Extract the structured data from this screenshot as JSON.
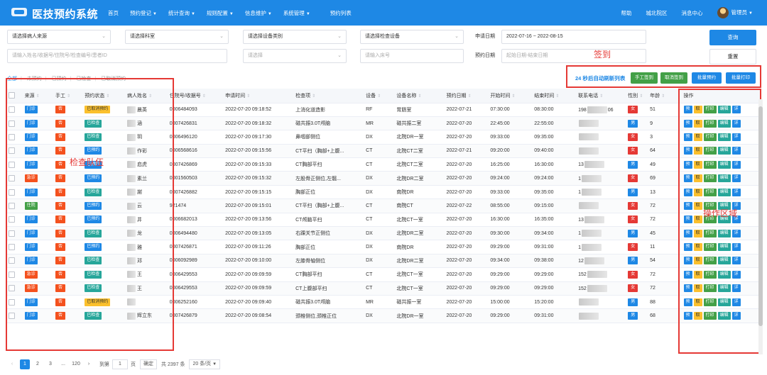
{
  "header": {
    "title": "医技预约系统",
    "nav": [
      {
        "label": "首页",
        "caret": false
      },
      {
        "label": "预约登记",
        "caret": true
      },
      {
        "label": "统计查询",
        "caret": true
      },
      {
        "label": "规则配置",
        "caret": true
      },
      {
        "label": "信息维护",
        "caret": true
      },
      {
        "label": "系统管理",
        "caret": true
      },
      {
        "label": "预约列表",
        "caret": false
      }
    ],
    "right": {
      "help": "帮助",
      "campus": "城北院区",
      "messages": "消息中心",
      "user": "管理员"
    }
  },
  "filters": {
    "patient_source": "请选择病人来源",
    "department": "请选择科室",
    "device_category": "请选择设备类别",
    "check_device": "请选择检查设备",
    "apply_date_label": "申请日期",
    "apply_date_value": "2022-07-16 ~ 2022-08-15",
    "search_placeholder": "请输入姓名/收据号/住院号/检查编号/患者ID",
    "select_placeholder": "请选择",
    "bed_placeholder": "请输入床号",
    "book_date_label": "预约日期",
    "book_date_placeholder": "起始日期-结束日期",
    "query_button": "查询",
    "reset_button": "重置"
  },
  "status_tabs": [
    "全部",
    "未预约",
    "已预约",
    "已检查",
    "已取消预约"
  ],
  "actions": {
    "refresh_text": "24 秒后自动刷新列表",
    "manual_checkin": "手工签到",
    "cancel_checkin": "取消签到",
    "batch_book": "批量预约",
    "batch_print": "批量打印"
  },
  "annotations": {
    "checkin": "签到",
    "check_queue": "检查队伍",
    "op_area": "操作区域"
  },
  "table": {
    "columns": [
      "来源",
      "手工",
      "预约状态",
      "病人姓名",
      "住院号/收据号",
      "申请时间",
      "检查项",
      "设备",
      "设备名称",
      "预约日期",
      "开始时间",
      "结束时间",
      "联系电话",
      "性别",
      "年龄",
      "",
      "操作"
    ],
    "op_labels": {
      "book": "预",
      "cancel": "取",
      "print": "打印",
      "edit": "编辑",
      "detail": "详"
    },
    "rows": [
      {
        "source": "门诊",
        "src": "mz",
        "manual": "否",
        "status": "已取消预约",
        "st": "cancel",
        "name": "晨英",
        "receipt": "0006484093",
        "apply": "2022-07-20 09:18:52",
        "item": "上消化道造影",
        "dev": "RF",
        "devname": "胃肠室",
        "bdate": "2022-07-21",
        "start": "07:30:00",
        "end": "08:30:00",
        "phone": "198",
        "phone_tail": "06",
        "sex": "女",
        "sx": "f",
        "age": "51"
      },
      {
        "source": "门诊",
        "src": "mz",
        "manual": "否",
        "status": "已检查",
        "st": "done",
        "name": "涵",
        "receipt": "0007426831",
        "apply": "2022-07-20 09:18:32",
        "item": "磁共振3.0T颅脑",
        "dev": "MR",
        "devname": "磁共振二室",
        "bdate": "2022-07-20",
        "start": "22:45:00",
        "end": "22:55:00",
        "phone": "",
        "phone_tail": "",
        "sex": "男",
        "sx": "m",
        "age": "9"
      },
      {
        "source": "门诊",
        "src": "mz",
        "manual": "否",
        "status": "已检查",
        "st": "done",
        "name": "玥",
        "receipt": "0006496120",
        "apply": "2022-07-20 09:17:30",
        "item": "鼻咽部侧位",
        "dev": "DX",
        "devname": "北院DR一室",
        "bdate": "2022-07-20",
        "start": "09:33:00",
        "end": "09:35:00",
        "phone": "",
        "phone_tail": "",
        "sex": "女",
        "sx": "f",
        "age": "3"
      },
      {
        "source": "门诊",
        "src": "mz",
        "manual": "否",
        "status": "已预约",
        "st": "booked",
        "name": "作彩",
        "receipt": "0006568616",
        "apply": "2022-07-20 09:15:56",
        "item": "CT平扫（胸部+上腹...",
        "dev": "CT",
        "devname": "北院CT二室",
        "bdate": "2022-07-21",
        "start": "09:20:00",
        "end": "09:40:00",
        "phone": "",
        "phone_tail": "",
        "sex": "女",
        "sx": "f",
        "age": "64"
      },
      {
        "source": "门诊",
        "src": "mz",
        "manual": "否",
        "status": "已预约",
        "st": "booked",
        "name": "启虎",
        "receipt": "0007426869",
        "apply": "2022-07-20 09:15:33",
        "item": "CT胸部平扫",
        "dev": "CT",
        "devname": "北院CT二室",
        "bdate": "2022-07-20",
        "start": "16:25:00",
        "end": "16:30:00",
        "phone": "13",
        "phone_tail": "",
        "sex": "男",
        "sx": "m",
        "age": "49"
      },
      {
        "source": "急诊",
        "src": "jz",
        "manual": "否",
        "status": "已预约",
        "st": "booked",
        "name": "素兰",
        "receipt": "0001560503",
        "apply": "2022-07-20 09:15:32",
        "item": "左股骨正侧位,左髋...",
        "dev": "DX",
        "devname": "北院DR二室",
        "bdate": "2022-07-20",
        "start": "09:24:00",
        "end": "09:24:00",
        "phone": "1",
        "phone_tail": "",
        "sex": "女",
        "sx": "f",
        "age": "69"
      },
      {
        "source": "门诊",
        "src": "mz",
        "manual": "否",
        "status": "已检查",
        "st": "done",
        "name": "謝",
        "receipt": "0007426882",
        "apply": "2022-07-20 09:15:15",
        "item": "胸部正位",
        "dev": "DX",
        "devname": "南院DR",
        "bdate": "2022-07-20",
        "start": "09:33:00",
        "end": "09:35:00",
        "phone": "1",
        "phone_tail": "",
        "sex": "男",
        "sx": "m",
        "age": "13"
      },
      {
        "source": "住院",
        "src": "zy",
        "manual": "否",
        "status": "已预约",
        "st": "booked",
        "name": "云",
        "receipt": "921474",
        "apply": "2022-07-20 09:15:01",
        "item": "CT平扫（胸部+上腹...",
        "dev": "CT",
        "devname": "南院CT",
        "bdate": "2022-07-22",
        "start": "08:55:00",
        "end": "09:15:00",
        "phone": "",
        "phone_tail": "",
        "sex": "女",
        "sx": "f",
        "age": "72"
      },
      {
        "source": "门诊",
        "src": "mz",
        "manual": "否",
        "status": "已预约",
        "st": "booked",
        "name": "井",
        "receipt": "0006682013",
        "apply": "2022-07-20 09:13:56",
        "item": "CT颅脑平扫",
        "dev": "CT",
        "devname": "北院CT一室",
        "bdate": "2022-07-20",
        "start": "16:30:00",
        "end": "16:35:00",
        "phone": "13",
        "phone_tail": "",
        "sex": "女",
        "sx": "f",
        "age": "72"
      },
      {
        "source": "门诊",
        "src": "mz",
        "manual": "否",
        "status": "已检查",
        "st": "done",
        "name": "龙",
        "receipt": "0006494480",
        "apply": "2022-07-20 09:13:05",
        "item": "右踝关节正侧位",
        "dev": "DX",
        "devname": "北院DR二室",
        "bdate": "2022-07-20",
        "start": "09:30:00",
        "end": "09:34:00",
        "phone": "1",
        "phone_tail": "",
        "sex": "男",
        "sx": "m",
        "age": "45"
      },
      {
        "source": "门诊",
        "src": "mz",
        "manual": "否",
        "status": "已预约",
        "st": "booked",
        "name": "雅",
        "receipt": "0007426871",
        "apply": "2022-07-20 09:11:26",
        "item": "胸部正位",
        "dev": "DX",
        "devname": "南院DR",
        "bdate": "2022-07-20",
        "start": "09:29:00",
        "end": "09:31:00",
        "phone": "1",
        "phone_tail": "",
        "sex": "女",
        "sx": "f",
        "age": "11"
      },
      {
        "source": "门诊",
        "src": "mz",
        "manual": "否",
        "status": "已检查",
        "st": "done",
        "name": "邓",
        "receipt": "0006092989",
        "apply": "2022-07-20 09:10:00",
        "item": "左膝骨轴侧位",
        "dev": "DX",
        "devname": "北院DR二室",
        "bdate": "2022-07-20",
        "start": "09:34:00",
        "end": "09:38:00",
        "phone": "12",
        "phone_tail": "",
        "sex": "男",
        "sx": "m",
        "age": "54"
      },
      {
        "source": "急诊",
        "src": "jz",
        "manual": "否",
        "status": "已检查",
        "st": "done",
        "name": "王",
        "receipt": "0006429553",
        "apply": "2022-07-20 09:09:59",
        "item": "CT胸部平扫",
        "dev": "CT",
        "devname": "北院CT一室",
        "bdate": "2022-07-20",
        "start": "09:29:00",
        "end": "09:29:00",
        "phone": "152",
        "phone_tail": "",
        "sex": "女",
        "sx": "f",
        "age": "72"
      },
      {
        "source": "急诊",
        "src": "jz",
        "manual": "否",
        "status": "已检查",
        "st": "done",
        "name": "王",
        "receipt": "0006429553",
        "apply": "2022-07-20 09:09:59",
        "item": "CT上腹部平扫",
        "dev": "CT",
        "devname": "北院CT一室",
        "bdate": "2022-07-20",
        "start": "09:29:00",
        "end": "09:29:00",
        "phone": "152",
        "phone_tail": "",
        "sex": "女",
        "sx": "f",
        "age": "72"
      },
      {
        "source": "门诊",
        "src": "mz",
        "manual": "否",
        "status": "已取消预约",
        "st": "cancel",
        "name": "",
        "receipt": "0006252160",
        "apply": "2022-07-20 09:09:40",
        "item": "磁共振3.0T颅脑",
        "dev": "MR",
        "devname": "磁共振一室",
        "bdate": "2022-07-20",
        "start": "15:00:00",
        "end": "15:20:00",
        "phone": "",
        "phone_tail": "",
        "sex": "男",
        "sx": "m",
        "age": "88"
      },
      {
        "source": "门诊",
        "src": "mz",
        "manual": "否",
        "status": "已检查",
        "st": "done",
        "name": "辉立东",
        "receipt": "0007426879",
        "apply": "2022-07-20 09:08:54",
        "item": "颈椎侧位,颈椎正位",
        "dev": "DX",
        "devname": "北院DR一室",
        "bdate": "2022-07-20",
        "start": "09:29:00",
        "end": "09:31:00",
        "phone": "",
        "phone_tail": "",
        "sex": "男",
        "sx": "m",
        "age": "68"
      }
    ]
  },
  "pager": {
    "p1": "1",
    "p2": "2",
    "p3": "3",
    "dots": "...",
    "last": "120",
    "goto": "到第",
    "page_input": "1",
    "page_unit": "页",
    "confirm": "确定",
    "total": "共 2397 条",
    "size": "20 条/页"
  }
}
